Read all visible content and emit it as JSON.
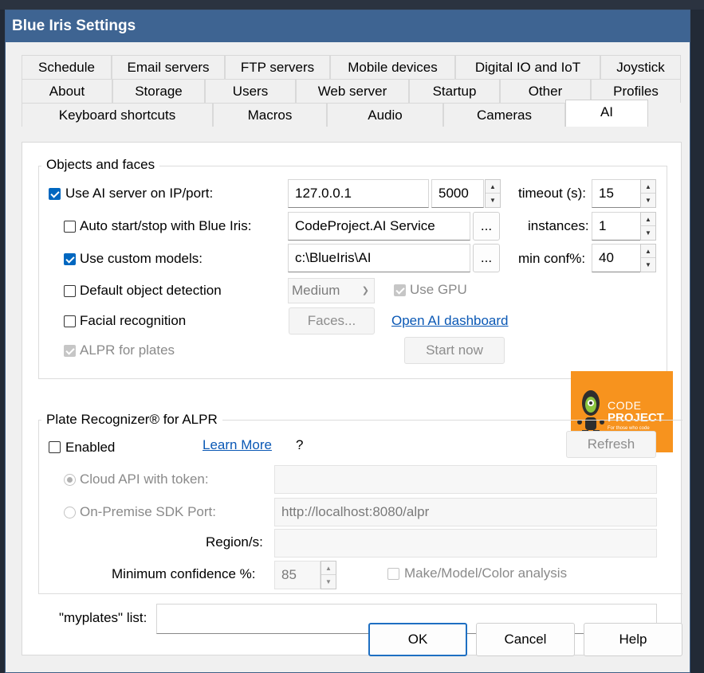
{
  "window": {
    "title": "Blue Iris Settings"
  },
  "tabs": {
    "row1": [
      "Schedule",
      "Email servers",
      "FTP servers",
      "Mobile devices",
      "Digital IO and IoT",
      "Joystick"
    ],
    "row2": [
      "About",
      "Storage",
      "Users",
      "Web server",
      "Startup",
      "Other",
      "Profiles"
    ],
    "row3": [
      "Keyboard shortcuts",
      "Macros",
      "Audio",
      "Cameras",
      "AI"
    ],
    "active": "AI"
  },
  "objects": {
    "group_title": "Objects and faces",
    "use_ai_label": "Use AI server on IP/port:",
    "use_ai_checked": true,
    "ip_value": "127.0.0.1",
    "port_value": "5000",
    "timeout_label": "timeout (s):",
    "timeout_value": "15",
    "autostart_label": "Auto start/stop with Blue Iris:",
    "autostart_checked": false,
    "service_value": "CodeProject.AI Service",
    "browse_label": "...",
    "instances_label": "instances:",
    "instances_value": "1",
    "custom_models_label": "Use custom models:",
    "custom_models_checked": true,
    "models_path": "c:\\BlueIris\\AI",
    "min_conf_label": "min conf%:",
    "min_conf_value": "40",
    "default_detect_label": "Default object detection",
    "default_detect_checked": false,
    "model_size": "Medium",
    "use_gpu_label": "Use GPU",
    "facial_label": "Facial recognition",
    "faces_button": "Faces...",
    "dashboard_link": "Open AI dashboard",
    "alpr_label": "ALPR for plates",
    "start_now_button": "Start now",
    "logo": {
      "line1": "CODE",
      "line2": "PROJECT",
      "tagline": "For those who code",
      "color": "#f7931e"
    }
  },
  "plate": {
    "group_title": "Plate Recognizer® for ALPR",
    "enabled_label": "Enabled",
    "learn_more": "Learn More",
    "help_mark": "?",
    "refresh_button": "Refresh",
    "cloud_label": "Cloud API with token:",
    "cloud_value": "",
    "onprem_label": "On-Premise SDK Port:",
    "onprem_value": "http://localhost:8080/alpr",
    "region_label": "Region/s:",
    "region_value": "",
    "min_conf_label": "Minimum confidence %:",
    "min_conf_value": "85",
    "mmc_label": "Make/Model/Color analysis"
  },
  "myplates": {
    "label": "\"myplates\" list:",
    "value": ""
  },
  "buttons": {
    "ok": "OK",
    "cancel": "Cancel",
    "help": "Help"
  }
}
